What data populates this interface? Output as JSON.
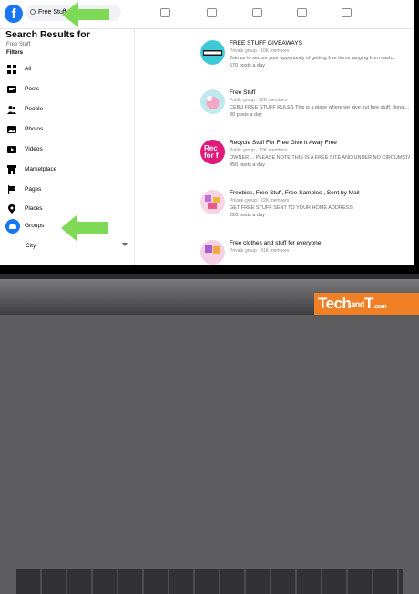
{
  "search": {
    "value": "Free Stuff"
  },
  "logo": {
    "letter": "f"
  },
  "sidebar": {
    "title": "Search Results for",
    "subtitle": "Free Stuff",
    "filters_label": "Filters",
    "items": [
      {
        "label": "All",
        "icon": "grid-icon"
      },
      {
        "label": "Posts",
        "icon": "posts-icon"
      },
      {
        "label": "People",
        "icon": "people-icon"
      },
      {
        "label": "Photos",
        "icon": "photos-icon"
      },
      {
        "label": "Videos",
        "icon": "video-icon"
      },
      {
        "label": "Marketplace",
        "icon": "marketplace-icon"
      },
      {
        "label": "Pages",
        "icon": "flag-icon"
      },
      {
        "label": "Places",
        "icon": "pin-icon"
      },
      {
        "label": "Groups",
        "icon": "groups-icon"
      },
      {
        "label": "City",
        "icon": ""
      }
    ]
  },
  "results": [
    {
      "name": "FREE STUFF GIVEAWAYS",
      "meta": "Private group · 10K members",
      "desc": "Join us to secure your opportunity of getting free items ranging from cash...",
      "posts": "570 posts a day"
    },
    {
      "name": "Free Stuff",
      "meta": "Public group · 22K members",
      "desc": "CEBU FREE STUFF RULES This is a place where we give out free stuff, donat...",
      "posts": "30 posts a day"
    },
    {
      "name": "Recycle Stuff For Free Give It Away Free",
      "meta": "Public group · 12K members",
      "desc": "OWNER ... PLEASE NOTE THIS IS A FREE SITE AND UNDER NO CIRCUMSTA...",
      "posts": "450 posts a day"
    },
    {
      "name": "Freebies, Free Stuff, Free Samples , Sent by Mail",
      "meta": "Private group · 22K members",
      "desc": "GET FREE STUFF SENT TO YOUR HOME ADDRESS",
      "posts": "220 posts a day"
    },
    {
      "name": "Free clothes and stuff for everyone",
      "meta": "Private group · 41K members",
      "desc": "",
      "posts": ""
    }
  ],
  "thumb3_text": "Rec for f",
  "watermark": {
    "tech": "Tech",
    "and": "and",
    "t": "T",
    "dot": ".com"
  },
  "colors": {
    "accent": "#1877f2",
    "arrow": "#7ed957",
    "watermark": "#f07f26"
  }
}
